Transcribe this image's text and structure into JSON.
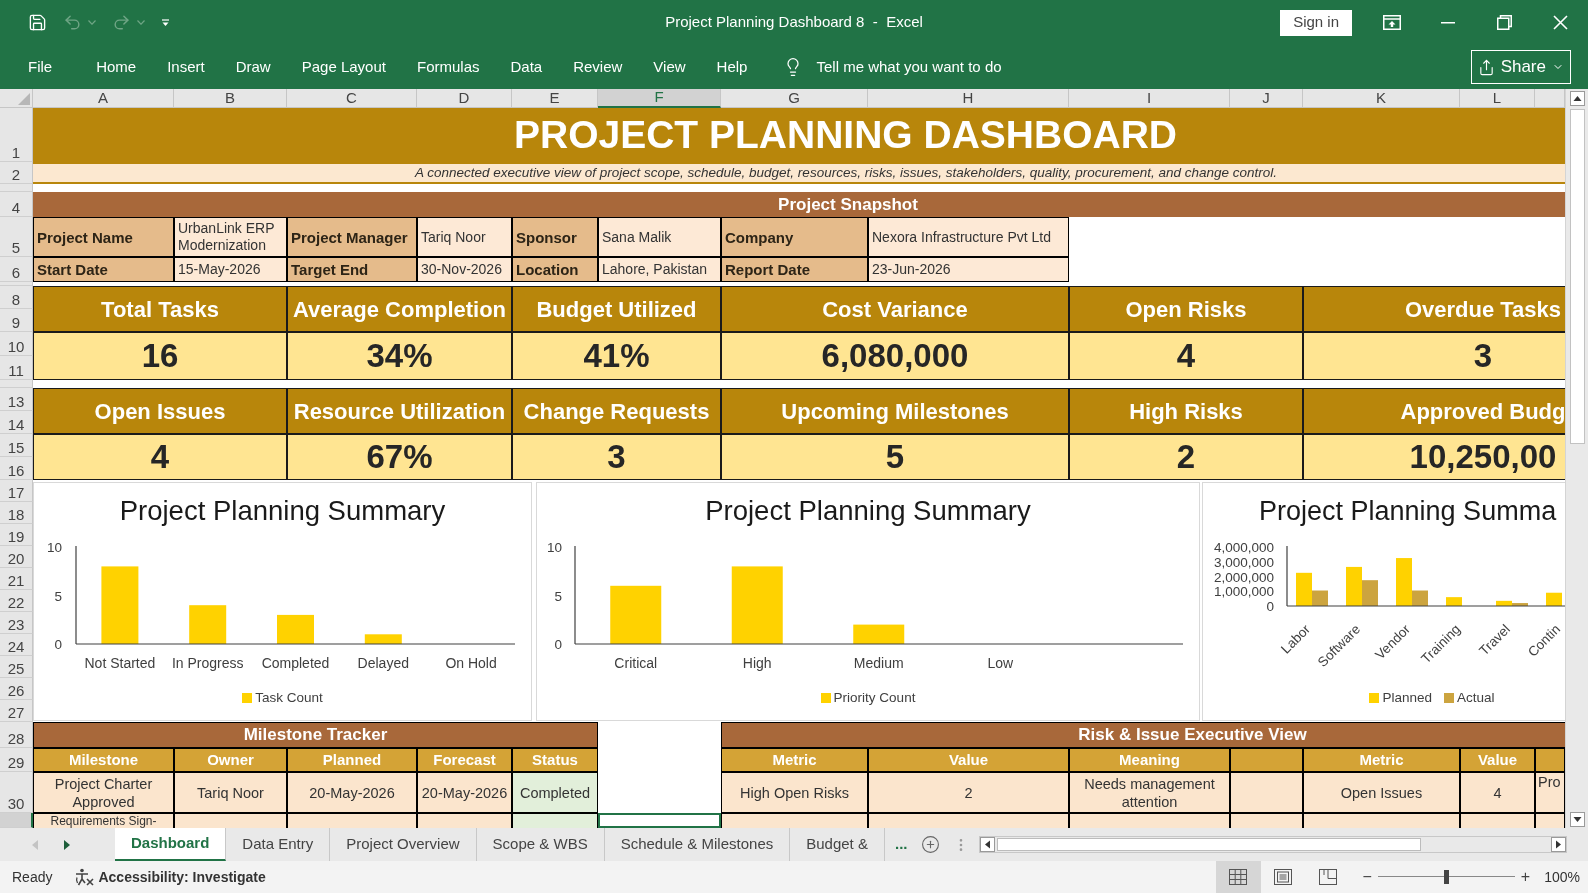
{
  "title_bar": {
    "quick_access": [
      {
        "kind": "save",
        "disabled": false
      },
      {
        "kind": "undo",
        "disabled": true
      },
      {
        "kind": "redo",
        "disabled": true
      },
      {
        "kind": "customize",
        "disabled": false
      }
    ],
    "document_title": "Project Planning Dashboard 8  -  Excel",
    "sign_in": "Sign in"
  },
  "ribbon": {
    "tabs": [
      "File",
      "Home",
      "Insert",
      "Draw",
      "Page Layout",
      "Formulas",
      "Data",
      "Review",
      "View",
      "Help"
    ],
    "tell_me": {
      "placeholder": "Tell me what you want to do"
    },
    "share": "Share"
  },
  "columns": [
    {
      "label": "A",
      "selected": false
    },
    {
      "label": "B",
      "selected": false
    },
    {
      "label": "C",
      "selected": false
    },
    {
      "label": "D",
      "selected": false
    },
    {
      "label": "E",
      "selected": false
    },
    {
      "label": "F",
      "selected": true
    },
    {
      "label": "G",
      "selected": false
    },
    {
      "label": "H",
      "selected": false
    },
    {
      "label": "I",
      "selected": false
    },
    {
      "label": "J",
      "selected": false
    },
    {
      "label": "K",
      "selected": false
    },
    {
      "label": "L",
      "selected": false
    },
    {
      "selected": false
    }
  ],
  "row_headers": [
    {
      "label": "1",
      "selected": false
    },
    {
      "label": "2",
      "selected": false
    },
    {
      "selected": false
    },
    {
      "label": "4",
      "selected": false
    },
    {
      "label": "5",
      "selected": false
    },
    {
      "label": "6",
      "selected": false
    },
    {
      "selected": false
    },
    {
      "label": "8",
      "selected": false
    },
    {
      "label": "9",
      "selected": false
    },
    {
      "label": "10",
      "selected": false
    },
    {
      "label": "11",
      "selected": false
    },
    {
      "selected": false
    },
    {
      "label": "13",
      "selected": false
    },
    {
      "label": "14",
      "selected": false
    },
    {
      "label": "15",
      "selected": false
    },
    {
      "label": "16",
      "selected": false
    },
    {
      "label": "17",
      "selected": false
    },
    {
      "label": "18",
      "selected": false
    },
    {
      "label": "19",
      "selected": false
    },
    {
      "label": "20",
      "selected": false
    },
    {
      "label": "21",
      "selected": false
    },
    {
      "label": "22",
      "selected": false
    },
    {
      "label": "23",
      "selected": false
    },
    {
      "label": "24",
      "selected": false
    },
    {
      "label": "25",
      "selected": false
    },
    {
      "label": "26",
      "selected": false
    },
    {
      "label": "27",
      "selected": false
    },
    {
      "label": "28",
      "selected": false
    },
    {
      "label": "29",
      "selected": false
    },
    {
      "label": "30",
      "selected": false
    },
    {
      "selected": true
    }
  ],
  "dashboard": {
    "title": "PROJECT PLANNING DASHBOARD",
    "subtitle": "A connected executive view of project scope, schedule, budget, resources, risks, issues, stakeholders, quality, procurement, and change control.",
    "snapshot": {
      "title": "Project Snapshot",
      "rows": [
        [
          {
            "label": "Project Name",
            "value": "UrbanLink ERP Modernization"
          },
          {
            "label": "Project Manager",
            "value": "Tariq Noor"
          },
          {
            "label": "Sponsor",
            "value": "Sana Malik"
          },
          {
            "label": "Company",
            "value": "Nexora Infrastructure Pvt Ltd"
          }
        ],
        [
          {
            "label": "Start Date",
            "value": "15-May-2026"
          },
          {
            "label": "Target End",
            "value": "30-Nov-2026"
          },
          {
            "label": "Location",
            "value": "Lahore, Pakistan"
          },
          {
            "label": "Report Date",
            "value": "23-Jun-2026"
          }
        ]
      ]
    },
    "kpi_rows": [
      [
        {
          "label": "Total Tasks",
          "value": "16"
        },
        {
          "label": "Average Completion",
          "value": "34%"
        },
        {
          "label": "Budget Utilized",
          "value": "41%"
        },
        {
          "label": "Cost Variance",
          "value": "6,080,000"
        },
        {
          "label": "Open Risks",
          "value": "4"
        },
        {
          "label": "Overdue Tasks",
          "value": "3"
        }
      ],
      [
        {
          "label": "Open Issues",
          "value": "4"
        },
        {
          "label": "Resource Utilization",
          "value": "67%"
        },
        {
          "label": "Change Requests",
          "value": "3"
        },
        {
          "label": "Upcoming Milestones",
          "value": "5"
        },
        {
          "label": "High Risks",
          "value": "2"
        },
        {
          "label": "Approved Budg",
          "value": "10,250,00"
        }
      ]
    ],
    "charts": [
      {
        "chart_data": {
          "type": "bar",
          "title": "Project Planning Summary",
          "categories": [
            "Not Started",
            "In Progress",
            "Completed",
            "Delayed",
            "On Hold"
          ],
          "series": [
            {
              "name": "Task Count",
              "color": "#ffd200",
              "values": [
                8,
                4,
                3,
                1,
                0
              ]
            }
          ],
          "ylim": [
            0,
            10
          ],
          "yticks": [
            0,
            5,
            10
          ],
          "legend": "bottom"
        }
      },
      {
        "chart_data": {
          "type": "bar",
          "title": "Project Planning Summary",
          "categories": [
            "Critical",
            "High",
            "Medium",
            "Low"
          ],
          "series": [
            {
              "name": "Priority Count",
              "color": "#ffd200",
              "values": [
                6,
                8,
                2,
                0
              ]
            }
          ],
          "ylim": [
            0,
            10
          ],
          "yticks": [
            0,
            5,
            10
          ],
          "legend": "bottom"
        }
      },
      {
        "chart_data": {
          "type": "bar",
          "title": "Project Planning Summa",
          "categories": [
            "Labor",
            "Software",
            "Vendor",
            "Training",
            "Travel",
            "Contin"
          ],
          "series": [
            {
              "name": "Planned",
              "color": "#ffd200",
              "values": [
                2250000,
                2650000,
                3250000,
                600000,
                350000,
                900000
              ]
            },
            {
              "name": "Actual",
              "color": "#cca43f",
              "values": [
                1050000,
                1750000,
                1050000,
                0,
                200000,
                null
              ]
            }
          ],
          "ylim": [
            0,
            4000000
          ],
          "yticks": [
            0,
            {
              "value": 1000000,
              "label": "1,000,000"
            },
            {
              "value": 2000000,
              "label": "2,000,000"
            },
            {
              "value": 3000000,
              "label": "3,000,000"
            },
            {
              "value": 4000000,
              "label": "4,000,000"
            }
          ],
          "legend": "bottom"
        }
      }
    ],
    "milestone_tracker": {
      "title": "Milestone Tracker",
      "columns": [
        "Milestone",
        "Owner",
        "Planned",
        "Forecast",
        "Status"
      ],
      "rows": [
        [
          "Project Charter Approved",
          "Tariq Noor",
          "20-May-2026",
          "20-May-2026",
          "Completed"
        ],
        [
          "Requirements Sign-",
          null,
          null,
          null,
          null
        ]
      ]
    },
    "risk_view": {
      "title": "Risk & Issue Executive View",
      "columns": [
        "Metric",
        "Value",
        "Meaning",
        null,
        "Metric",
        "Value",
        null
      ],
      "rows": [
        [
          "High Open Risks",
          "2",
          "Needs management attention",
          null,
          "Open Issues",
          "4",
          "Pro"
        ]
      ]
    }
  },
  "sheet_tabs": {
    "nav": [
      {
        "kind": "previous",
        "disabled": true
      },
      {
        "kind": "next",
        "disabled": false
      }
    ],
    "tabs": [
      {
        "label": "Dashboard",
        "selected": true
      },
      {
        "label": "Data Entry",
        "selected": false
      },
      {
        "label": "Project Overview",
        "selected": false
      },
      {
        "label": "Scope & WBS",
        "selected": false
      },
      {
        "label": "Schedule & Milestones",
        "selected": false
      },
      {
        "label": "Budget &",
        "selected": false
      }
    ],
    "more": "..."
  },
  "status_bar": {
    "status": "Ready",
    "accessibility": "Accessibility: Investigate",
    "views": [
      {
        "kind": "normal",
        "selected": true
      },
      {
        "kind": "page_layout",
        "selected": false
      },
      {
        "kind": "page_break",
        "selected": false
      }
    ],
    "zoom_out": "−",
    "zoom_slider": {
      "level": 0.5
    },
    "zoom_in": "+",
    "zoom_level": "100%"
  }
}
